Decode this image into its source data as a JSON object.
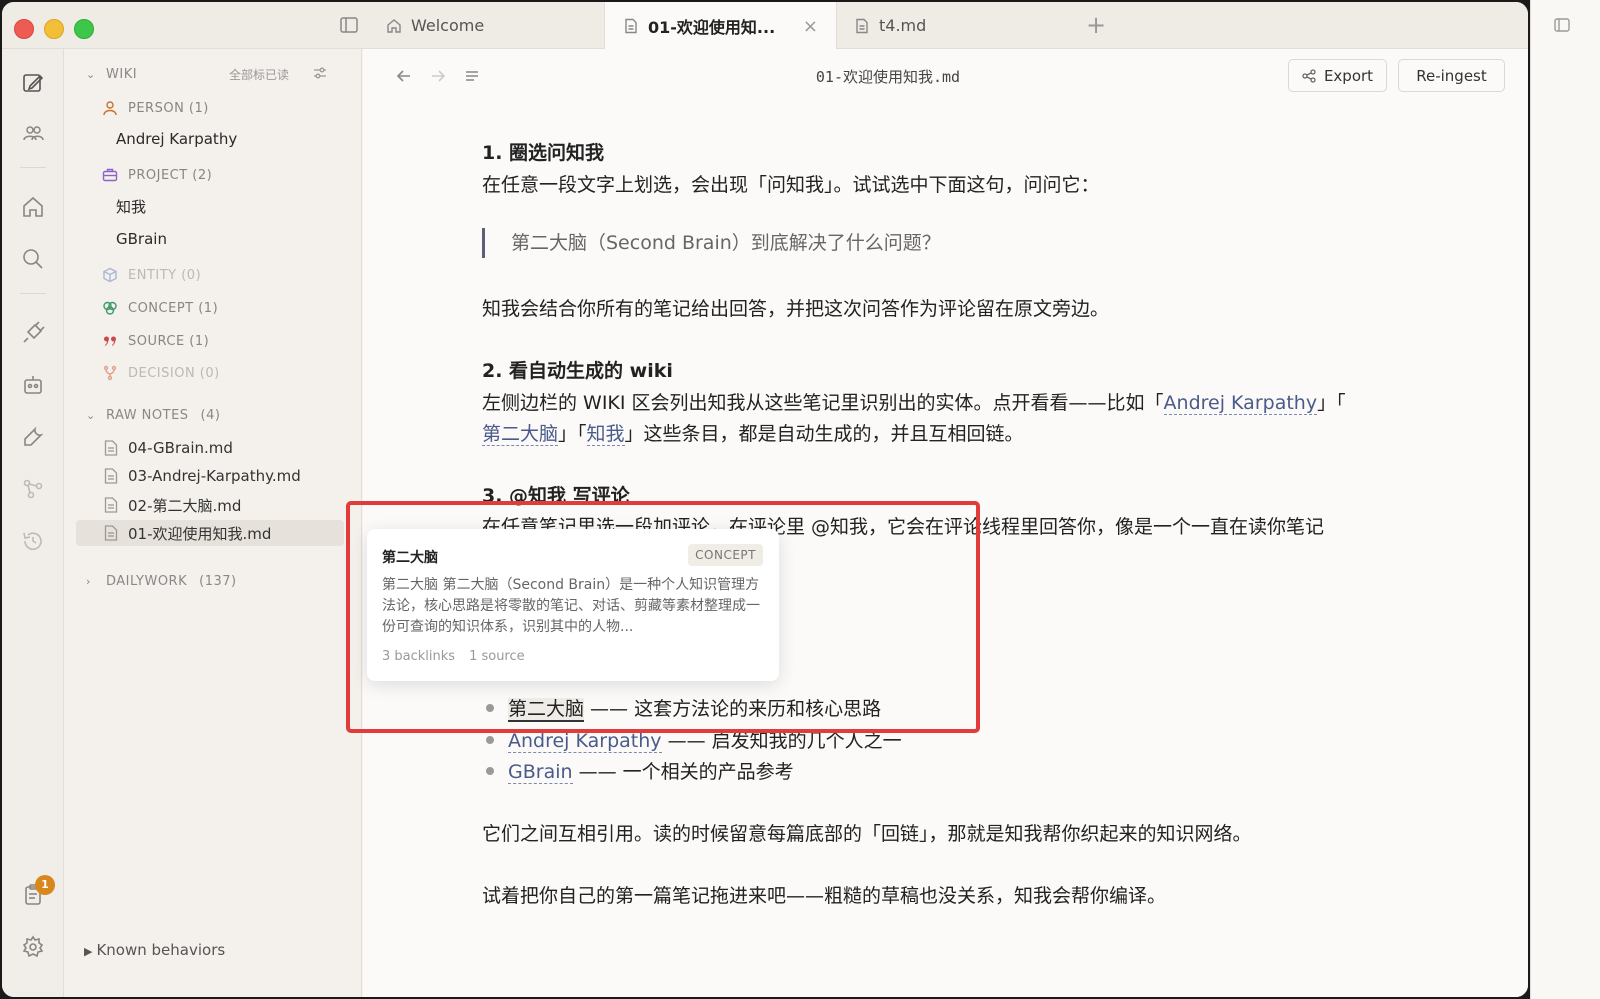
{
  "tabs": [
    {
      "label": "Welcome",
      "icon": "home-icon"
    },
    {
      "label": "01-欢迎使用知...",
      "icon": "file-icon",
      "close": "×"
    },
    {
      "label": "t4.md",
      "icon": "file-icon"
    }
  ],
  "tab_add": "+",
  "sidebar": {
    "wiki": {
      "title": "WIKI",
      "mark_all_read": "全部标已读",
      "categories": [
        {
          "label": "PERSON (1)",
          "icon": "person-icon",
          "items": [
            "Andrej Karpathy"
          ]
        },
        {
          "label": "PROJECT (2)",
          "icon": "briefcase-icon",
          "items": [
            "知我",
            "GBrain"
          ]
        },
        {
          "label": "ENTITY (0)",
          "icon": "cube-icon",
          "items": []
        },
        {
          "label": "CONCEPT (1)",
          "icon": "brain-icon",
          "items": []
        },
        {
          "label": "SOURCE (1)",
          "icon": "quote-icon",
          "items": []
        },
        {
          "label": "DECISION (0)",
          "icon": "fork-icon",
          "items": []
        }
      ]
    },
    "raw_notes": {
      "title": "RAW NOTES",
      "count": "(4)",
      "items": [
        "04-GBrain.md",
        "03-Andrej-Karpathy.md",
        "02-第二大脑.md",
        "01-欢迎使用知我.md"
      ]
    },
    "dailywork": {
      "title": "DAILYWORK",
      "count": "(137)"
    },
    "known_behaviors": "Known behaviors"
  },
  "activity_badge": "1",
  "editor": {
    "doc_title": "01-欢迎使用知我.md",
    "export_label": "Export",
    "reingest_label": "Re-ingest",
    "content": {
      "h1": "1. 圈选问知我",
      "p1": "在任意一段文字上划选，会出现「问知我」。试试选中下面这句，问问它：",
      "quote": "第二大脑（Second Brain）到底解决了什么问题？",
      "p2": "知我会结合你所有的笔记给出回答，并把这次问答作为评论留在原文旁边。",
      "h2": "2. 看自动生成的 wiki",
      "p3a": "左侧边栏的 WIKI 区会列出知我从这些笔记里识别出的实体。点开看看——比如「",
      "link_karpathy": "Andrej Karpathy",
      "p3b": "」「",
      "link_brain": "第二大脑",
      "p3c": "」「",
      "link_zhiwo": "知我",
      "p3d": "」这些条目，都是自动生成的，并且互相回链。",
      "h3": "3. @知我 写评论",
      "p4": "在任意笔记里选一段加评论，在评论里 @知我，它会在评论线程里回答你，像是一个一直在读你笔记",
      "bullets": [
        {
          "link": "第二大脑",
          "text": " —— 这套方法论的来历和核心思路"
        },
        {
          "link": "Andrej Karpathy",
          "text": " —— 启发知我的几个人之一"
        },
        {
          "link": "GBrain",
          "text": " —— 一个相关的产品参考"
        }
      ],
      "p5": "它们之间互相引用。读的时候留意每篇底部的「回链」，那就是知我帮你织起来的知识网络。",
      "p6": "试着把你自己的第一篇笔记拖进来吧——粗糙的草稿也没关系，知我会帮你编译。"
    }
  },
  "popover": {
    "title": "第二大脑",
    "tag": "CONCEPT",
    "body": "第二大脑 第二大脑（Second Brain）是一种个人知识管理方法论，核心思路是将零散的笔记、对话、剪藏等素材整理成一份可查询的知识体系，识别其中的人物...",
    "backlinks": "3 backlinks",
    "sources": "1 source"
  }
}
